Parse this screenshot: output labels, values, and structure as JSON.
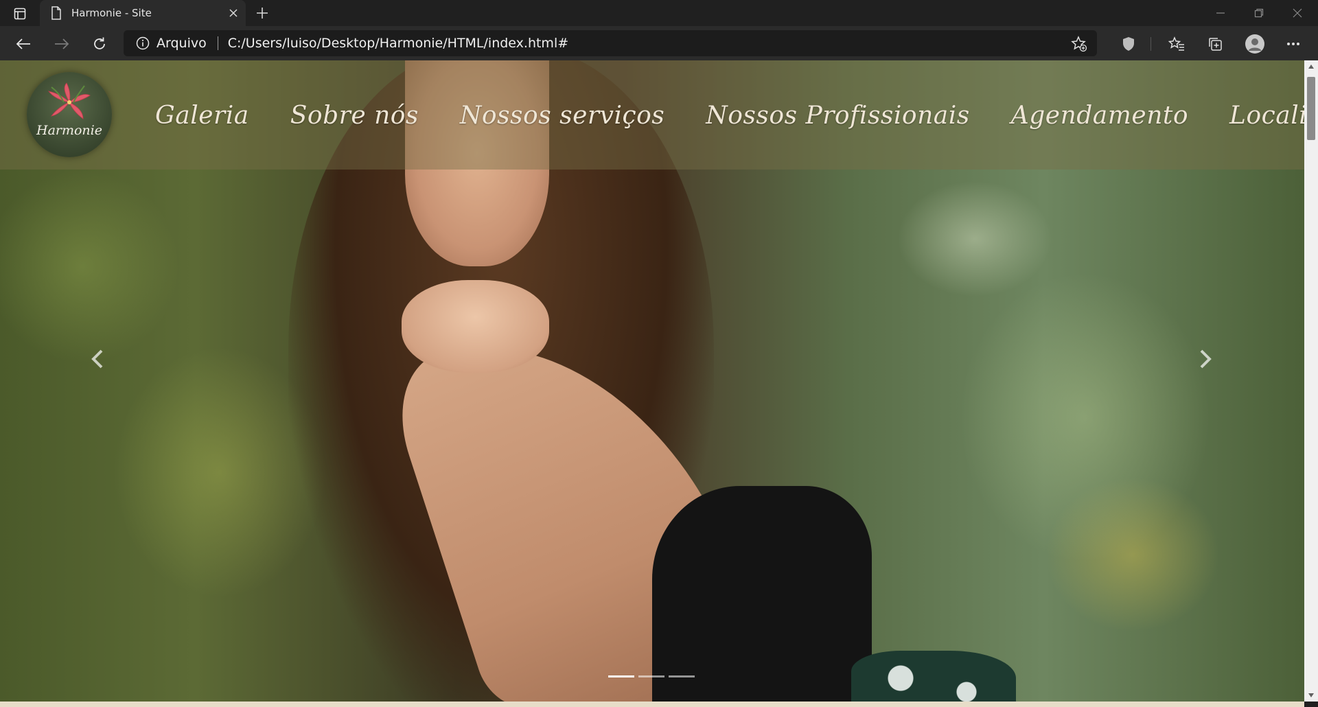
{
  "browser": {
    "tab_title": "Harmonie - Site",
    "address": {
      "scheme_label": "Arquivo",
      "url": "C:/Users/luiso/Desktop/Harmonie/HTML/index.html#"
    }
  },
  "site": {
    "logo_text": "Harmonie",
    "nav": [
      {
        "label": "Galeria"
      },
      {
        "label": "Sobre nós"
      },
      {
        "label": "Nossos serviços"
      },
      {
        "label": "Nossos Profissionais"
      },
      {
        "label": "Agendamento"
      },
      {
        "label": "Localização"
      }
    ],
    "carousel": {
      "slide_count": 3,
      "active_index": 0
    }
  },
  "colors": {
    "chrome_dark": "#202020",
    "chrome_toolbar": "#2b2b2b",
    "nav_text": "#efe6d6",
    "logo_flower": "#e05a6a"
  }
}
